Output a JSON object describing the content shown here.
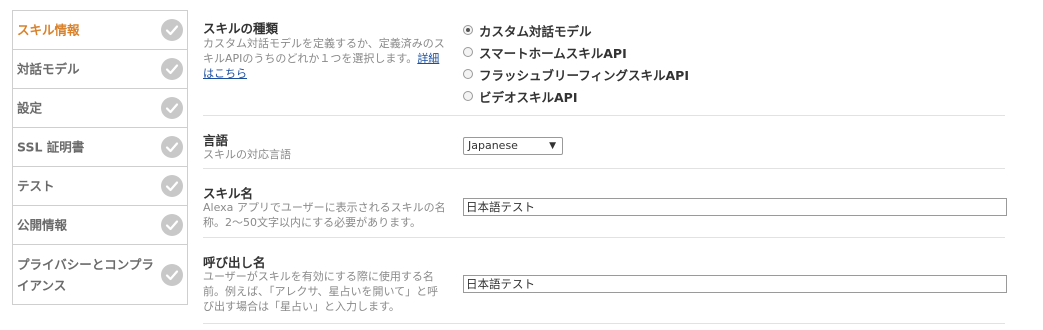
{
  "sidebar": {
    "items": [
      {
        "label": "スキル情報",
        "active": true
      },
      {
        "label": "対話モデル"
      },
      {
        "label": "設定"
      },
      {
        "label": "SSL 証明書"
      },
      {
        "label": "テスト"
      },
      {
        "label": "公開情報"
      },
      {
        "label": "プライバシーとコンプライアンス"
      }
    ]
  },
  "skill_type": {
    "title": "スキルの種類",
    "description": "カスタム対話モデルを定義するか、定義済みのスキルAPIのうちのどれか１つを選択します。",
    "link_text": "詳細はこちら",
    "options": [
      {
        "label": "カスタム対話モデル",
        "checked": true
      },
      {
        "label": "スマートホームスキルAPI"
      },
      {
        "label": "フラッシュブリーフィングスキルAPI"
      },
      {
        "label": "ビデオスキルAPI"
      }
    ]
  },
  "language": {
    "title": "言語",
    "description": "スキルの対応言語",
    "selected": "Japanese"
  },
  "skill_name": {
    "title": "スキル名",
    "description": "Alexa アプリでユーザーに表示されるスキルの名称。2～50文字以内にする必要があります。",
    "value": "日本語テスト"
  },
  "invocation_name": {
    "title": "呼び出し名",
    "description": "ユーザーがスキルを有効にする際に使用する名前。例えば、「アレクサ、星占いを開いて」と呼び出す場合は「星占い」と入力します。",
    "value": "日本語テスト"
  },
  "icons": {
    "check": "check-circle-icon",
    "dropdown": "caret-down-icon"
  },
  "colors": {
    "active": "#d9822b",
    "link": "#1a4fa0",
    "check_bg": "#c8c8c8"
  }
}
